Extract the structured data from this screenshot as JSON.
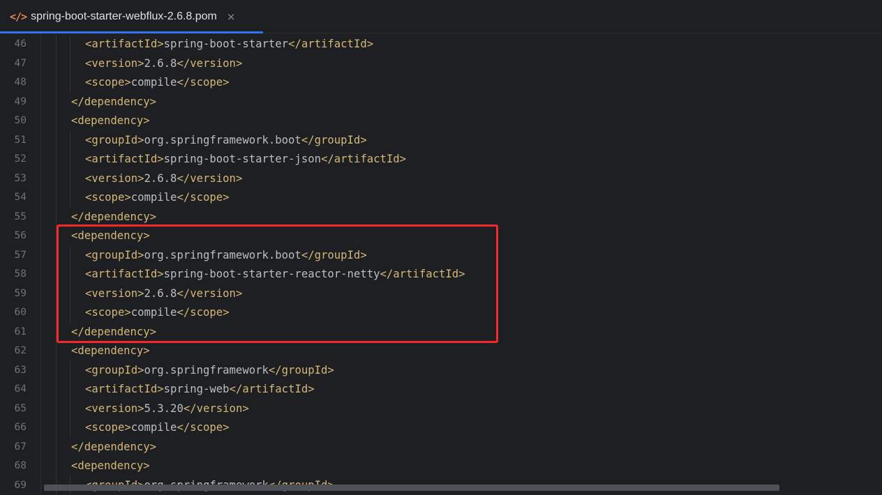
{
  "tab": {
    "icon": "</>",
    "icon_name": "xml-file-icon",
    "title": "spring-boot-starter-webflux-2.6.8.pom",
    "close_glyph": "×"
  },
  "colors": {
    "background": "#1e1f22",
    "tag": "#d5b778",
    "text": "#bcbec4",
    "line_number": "#6f737a",
    "tab_underline": "#3574f0",
    "highlight_box": "#f5292b"
  },
  "code": {
    "lines": [
      {
        "num": "46",
        "indent": 2,
        "open": "<artifactId>",
        "text": "spring-boot-starter",
        "close": "</artifactId>"
      },
      {
        "num": "47",
        "indent": 2,
        "open": "<version>",
        "text": "2.6.8",
        "close": "</version>"
      },
      {
        "num": "48",
        "indent": 2,
        "open": "<scope>",
        "text": "compile",
        "close": "</scope>"
      },
      {
        "num": "49",
        "indent": 1,
        "open": "</dependency>",
        "text": "",
        "close": ""
      },
      {
        "num": "50",
        "indent": 1,
        "open": "<dependency>",
        "text": "",
        "close": ""
      },
      {
        "num": "51",
        "indent": 2,
        "open": "<groupId>",
        "text": "org.springframework.boot",
        "close": "</groupId>"
      },
      {
        "num": "52",
        "indent": 2,
        "open": "<artifactId>",
        "text": "spring-boot-starter-json",
        "close": "</artifactId>"
      },
      {
        "num": "53",
        "indent": 2,
        "open": "<version>",
        "text": "2.6.8",
        "close": "</version>"
      },
      {
        "num": "54",
        "indent": 2,
        "open": "<scope>",
        "text": "compile",
        "close": "</scope>"
      },
      {
        "num": "55",
        "indent": 1,
        "open": "</dependency>",
        "text": "",
        "close": ""
      },
      {
        "num": "56",
        "indent": 1,
        "open": "<dependency>",
        "text": "",
        "close": ""
      },
      {
        "num": "57",
        "indent": 2,
        "open": "<groupId>",
        "text": "org.springframework.boot",
        "close": "</groupId>"
      },
      {
        "num": "58",
        "indent": 2,
        "open": "<artifactId>",
        "text": "spring-boot-starter-reactor-netty",
        "close": "</artifactId>"
      },
      {
        "num": "59",
        "indent": 2,
        "open": "<version>",
        "text": "2.6.8",
        "close": "</version>"
      },
      {
        "num": "60",
        "indent": 2,
        "open": "<scope>",
        "text": "compile",
        "close": "</scope>"
      },
      {
        "num": "61",
        "indent": 1,
        "open": "</dependency>",
        "text": "",
        "close": ""
      },
      {
        "num": "62",
        "indent": 1,
        "open": "<dependency>",
        "text": "",
        "close": ""
      },
      {
        "num": "63",
        "indent": 2,
        "open": "<groupId>",
        "text": "org.springframework",
        "close": "</groupId>"
      },
      {
        "num": "64",
        "indent": 2,
        "open": "<artifactId>",
        "text": "spring-web",
        "close": "</artifactId>"
      },
      {
        "num": "65",
        "indent": 2,
        "open": "<version>",
        "text": "5.3.20",
        "close": "</version>"
      },
      {
        "num": "66",
        "indent": 2,
        "open": "<scope>",
        "text": "compile",
        "close": "</scope>"
      },
      {
        "num": "67",
        "indent": 1,
        "open": "</dependency>",
        "text": "",
        "close": ""
      },
      {
        "num": "68",
        "indent": 1,
        "open": "<dependency>",
        "text": "",
        "close": ""
      },
      {
        "num": "69",
        "indent": 2,
        "open": "<groupId>",
        "text": "org.springframework",
        "close": "</groupId>"
      }
    ]
  }
}
